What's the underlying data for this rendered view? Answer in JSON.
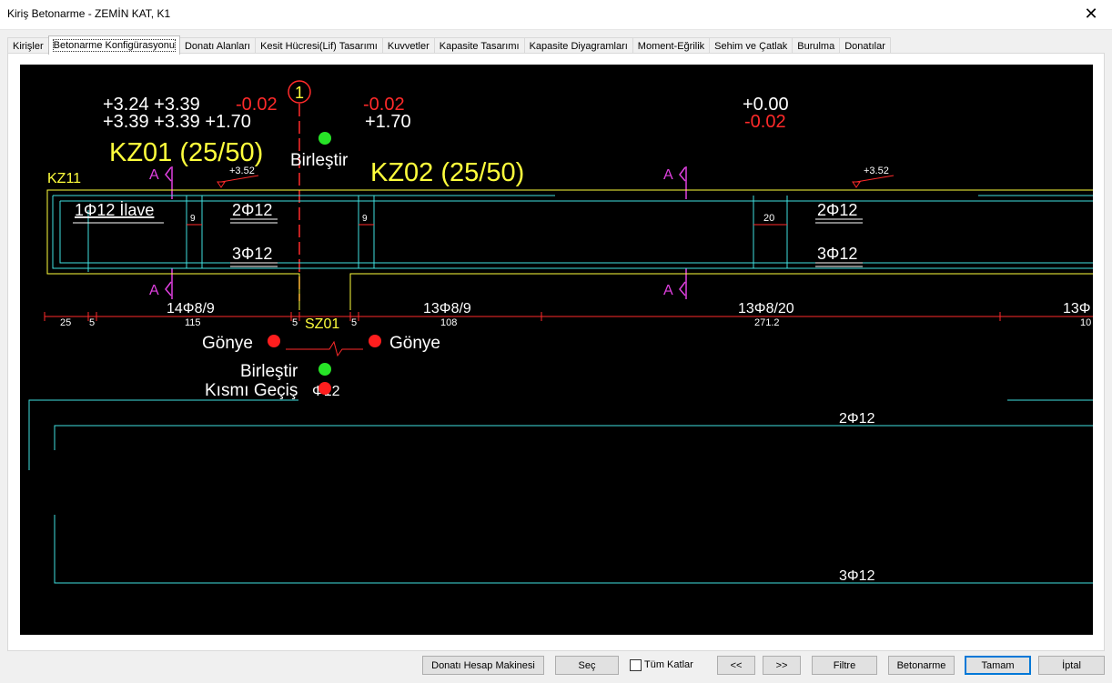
{
  "window": {
    "title": "Kiriş Betonarme - ZEMİN KAT, K1",
    "close_glyph": "✕"
  },
  "tabs": [
    {
      "label": "Kirişler"
    },
    {
      "label": "Betonarme Konfigürasyonu"
    },
    {
      "label": "Donatı Alanları"
    },
    {
      "label": "Kesit Hücresi(Lif) Tasarımı"
    },
    {
      "label": "Kuvvetler"
    },
    {
      "label": "Kapasite Tasarımı"
    },
    {
      "label": "Kapasite Diyagramları"
    },
    {
      "label": "Moment-Eğrilik"
    },
    {
      "label": "Sehim ve Çatlak"
    },
    {
      "label": "Burulma"
    },
    {
      "label": "Donatılar"
    }
  ],
  "active_tab": 1,
  "drawing": {
    "elev_l1": "+3.24 +3.39",
    "elev_l1_red": "-0.02",
    "elev_l2": "+3.39 +3.39 +1.70",
    "axis_label": "1",
    "elev_m1": "-0.02",
    "elev_m2": "+1.70",
    "elev_r1": "+0.00",
    "elev_r2": "-0.02",
    "beam1": "KZ01 (25/50)",
    "beam2": "KZ02 (25/50)",
    "beam_left": "KZ11",
    "merge_top": "Birleştir",
    "section_mark": "A",
    "level_mark": "+3.52",
    "bar_extra": "1Φ12 İlave",
    "bar_top": "2Φ12",
    "bar_bottom": "3Φ12",
    "dim_9": "9",
    "dim_20": "20",
    "stirrup1": "14Φ8/9",
    "stirrup2": "13Φ8/9",
    "stirrup3": "13Φ8/20",
    "stirrup4": "13Φ",
    "dim_25": "25",
    "dim_5": "5",
    "dim_115": "115",
    "dim_108": "108",
    "dim_2712": "271.2",
    "dim_10": "10",
    "column": "SZ01",
    "gonye": "Gönye",
    "merge_bottom": "Birleştir",
    "partial": "Kısmı Geçiş",
    "overlap_text": "Φ12",
    "long_top": "2Φ12",
    "long_bottom": "3Φ12"
  },
  "colors": {
    "white": "#ffffff",
    "red": "#ff2a2a",
    "yellow": "#ffff3c",
    "magenta": "#e040e0",
    "cyan": "#40e0e0",
    "green": "#27e427",
    "dot_red": "#ff1e1e"
  },
  "buttons": {
    "calc": "Donatı Hesap Makinesi",
    "select": "Seç",
    "all_floors": "Tüm Katlar",
    "prev": "<<",
    "next": ">>",
    "filter": "Filtre",
    "concrete": "Betonarme",
    "ok": "Tamam",
    "cancel": "İptal"
  }
}
